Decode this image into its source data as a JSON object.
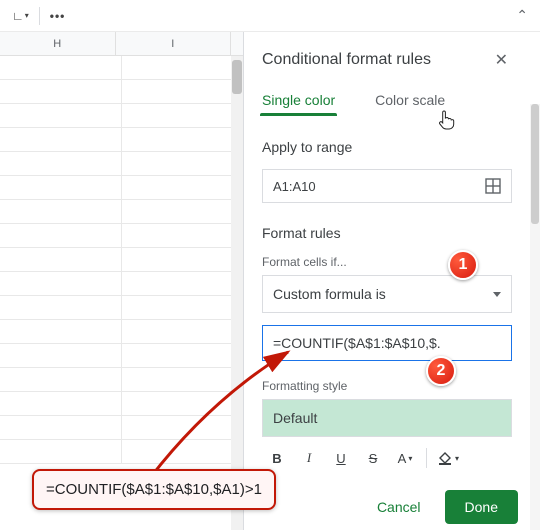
{
  "toolbar": {
    "left_control_suffix": "▾"
  },
  "columns": [
    "H",
    "I"
  ],
  "panel": {
    "title": "Conditional format rules",
    "tabs": {
      "single": "Single color",
      "scale": "Color scale"
    },
    "apply_label": "Apply to range",
    "range_value": "A1:A10",
    "rules_label": "Format rules",
    "format_if_label": "Format cells if...",
    "condition_value": "Custom formula is",
    "formula_display": "=COUNTIF($A$1:$A$10,$.",
    "formula_full": "=COUNTIF($A$1:$A$10,$A1)>1",
    "style_label": "Formatting style",
    "style_preview": "Default",
    "cancel": "Cancel",
    "done": "Done"
  },
  "badges": {
    "one": "1",
    "two": "2"
  },
  "colors": {
    "accent": "#188038",
    "badge": "#e03320",
    "callout_border": "#c21807"
  }
}
